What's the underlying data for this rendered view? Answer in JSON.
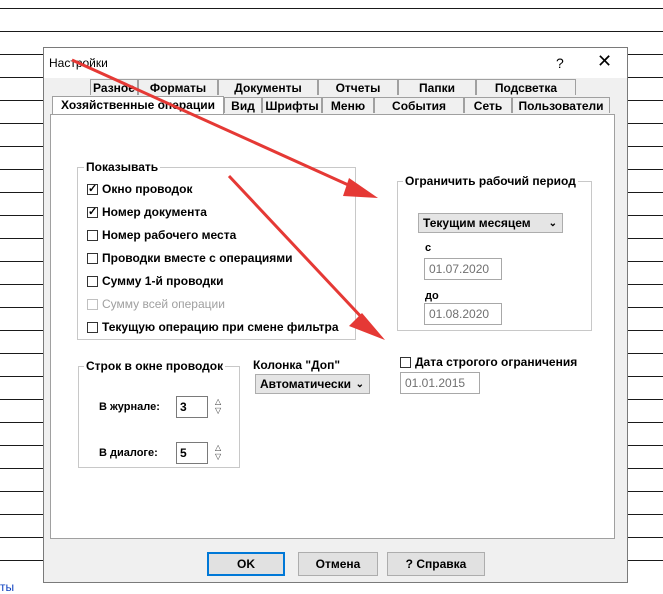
{
  "link_fragment": "ты",
  "dialog": {
    "title": "Настройки",
    "help_icon": "?",
    "close_icon": "✕",
    "tabs_back": [
      "Разное",
      "Форматы",
      "Документы",
      "Отчеты",
      "Папки",
      "Подсветка"
    ],
    "tabs_front": [
      "Хозяйственные операции",
      "Вид",
      "Шрифты",
      "Меню",
      "События",
      "Сеть",
      "Пользователи"
    ],
    "show_group": {
      "label": "Показывать",
      "items": [
        {
          "label": "Окно проводок",
          "checked": true,
          "disabled": false
        },
        {
          "label": "Номер документа",
          "checked": true,
          "disabled": false
        },
        {
          "label": "Номер рабочего места",
          "checked": false,
          "disabled": false
        },
        {
          "label": "Проводки вместе с операциями",
          "checked": false,
          "disabled": false
        },
        {
          "label": "Сумму 1-й проводки",
          "checked": false,
          "disabled": false
        },
        {
          "label": "Сумму всей операции",
          "checked": false,
          "disabled": true
        },
        {
          "label": "Текущую операцию при смене фильтра",
          "checked": false,
          "disabled": false
        }
      ]
    },
    "period_group": {
      "label": "Ограничить рабочий период",
      "mode": "Текущим месяцем",
      "from_label": "с",
      "from_value": "01.07.2020",
      "to_label": "до",
      "to_value": "01.08.2020"
    },
    "strict_limit": {
      "label": "Дата строгого ограничения",
      "checked": false,
      "value": "01.01.2015"
    },
    "rows_group": {
      "label": "Строк в окне проводок",
      "journal_label": "В журнале:",
      "journal_value": "3",
      "dialog_label": "В диалоге:",
      "dialog_value": "5"
    },
    "dop_column": {
      "label": "Колонка \"Доп\"",
      "value": "Автоматически"
    },
    "buttons": {
      "ok": "OK",
      "cancel": "Отмена",
      "help": "? Справка"
    }
  },
  "annotation_color": "#e53935"
}
